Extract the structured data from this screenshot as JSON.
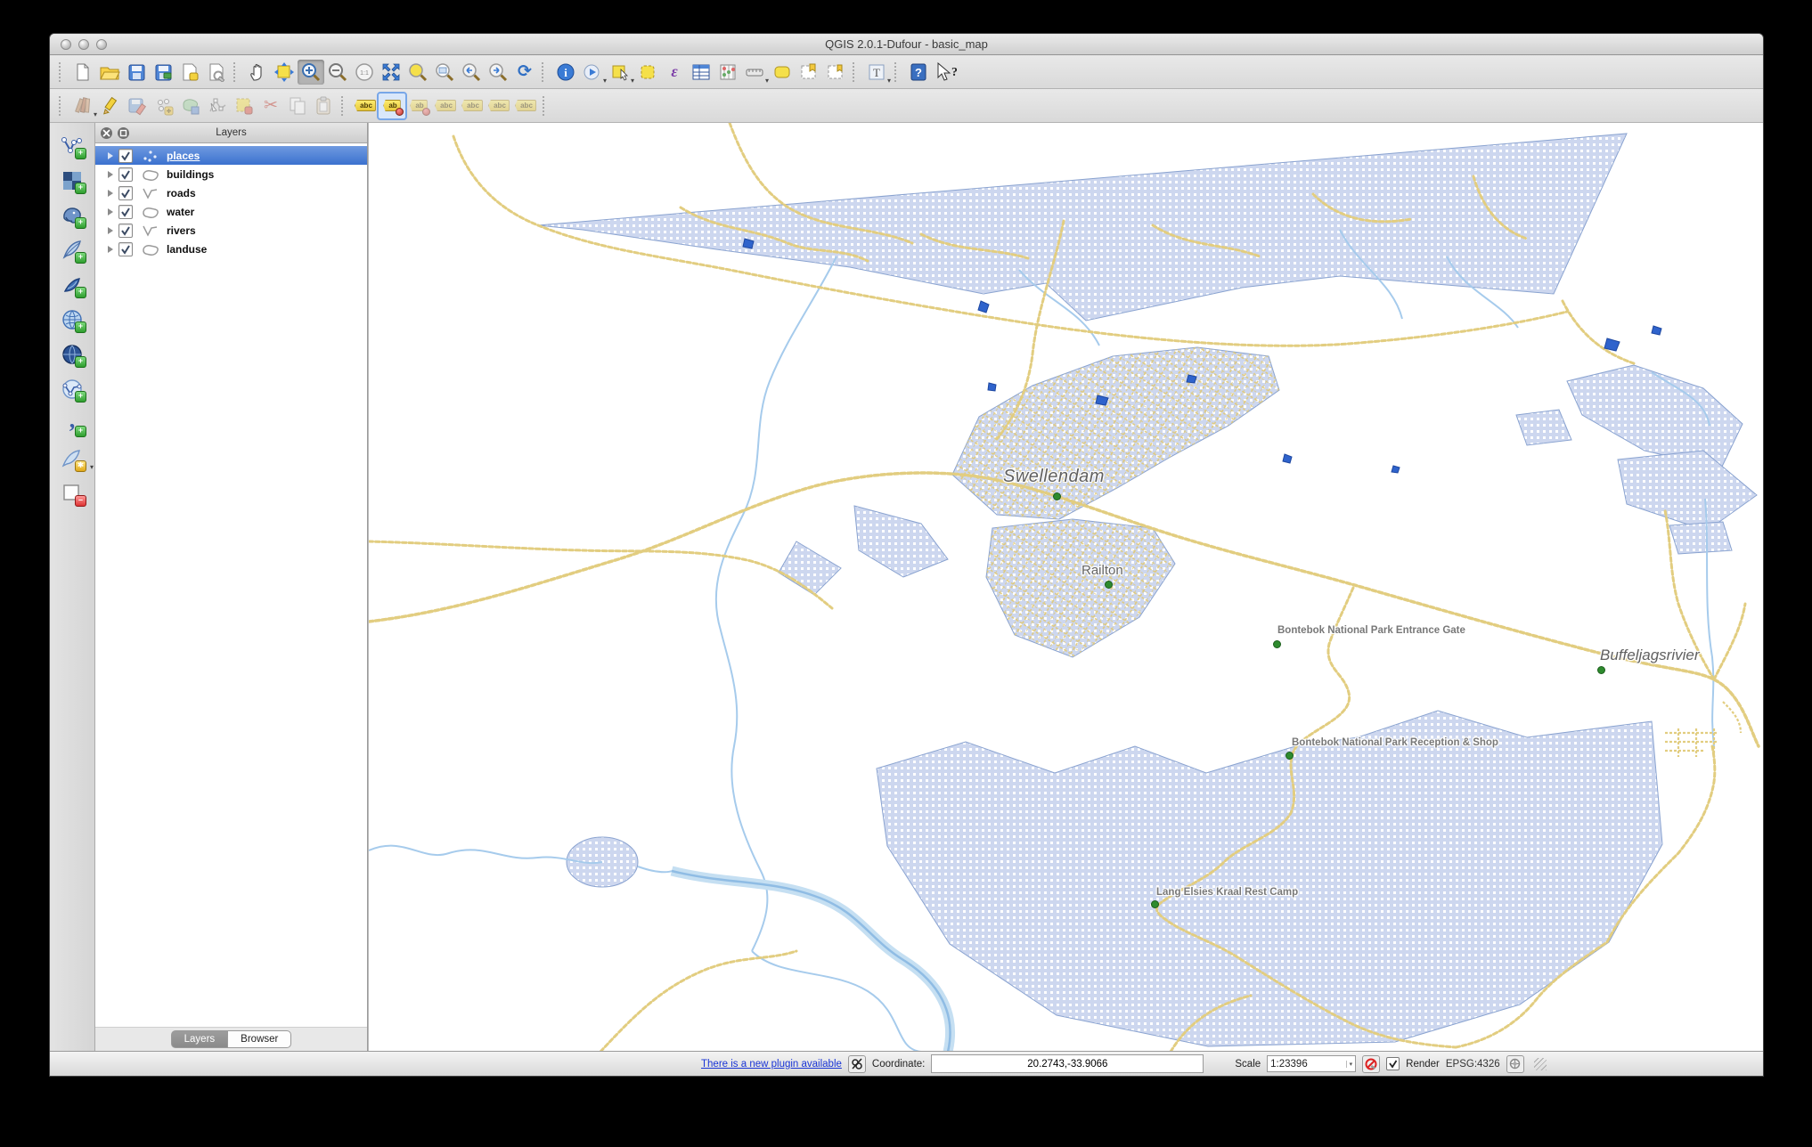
{
  "window": {
    "title": "QGIS 2.0.1-Dufour - basic_map"
  },
  "toolbar_text": {
    "zoom_native": "1:1",
    "identify": "i",
    "expression": "ε",
    "text_annotation": "T",
    "help": "?",
    "whats_this": "?",
    "label_abc": "abc",
    "label_ab": "ab"
  },
  "toolbars": {
    "main": [
      "new-project",
      "open-project",
      "save-project",
      "save-project-as",
      "new-print-composer",
      "composer-manager",
      "pan-map",
      "pan-to-selection",
      "zoom-in",
      "zoom-out",
      "zoom-native",
      "zoom-full",
      "zoom-to-selection",
      "zoom-to-layer",
      "zoom-last",
      "zoom-next",
      "refresh",
      "identify-features",
      "run-feature-action",
      "select-features",
      "deselect-features",
      "select-by-expression",
      "open-attribute-table",
      "field-calculator",
      "measure-line",
      "map-tips",
      "new-bookmark",
      "show-bookmarks",
      "text-annotation",
      "help-contents",
      "whats-this"
    ],
    "digitizing": [
      "current-edits",
      "toggle-editing",
      "save-layer-edits",
      "add-feature",
      "move-feature",
      "node-tool",
      "delete-selected",
      "cut-features",
      "copy-features",
      "paste-features"
    ],
    "labeling": [
      "layer-labeling-options",
      "pin-labels",
      "highlight-pinned-labels",
      "move-label",
      "rotate-label",
      "change-label",
      "change-label-properties"
    ],
    "manage_layers": [
      "add-vector-layer",
      "add-raster-layer",
      "add-postgis-layer",
      "add-spatialite-layer",
      "add-mssql-layer",
      "add-wms-layer",
      "add-wcs-layer",
      "add-wfs-layer",
      "add-delimited-text-layer",
      "new-shapefile-layer",
      "remove-layer"
    ]
  },
  "layers_panel": {
    "title": "Layers",
    "items": [
      {
        "label": "places",
        "type": "point",
        "checked": true,
        "selected": true
      },
      {
        "label": "buildings",
        "type": "polygon",
        "checked": true,
        "selected": false
      },
      {
        "label": "roads",
        "type": "line",
        "checked": true,
        "selected": false
      },
      {
        "label": "water",
        "type": "polygon",
        "checked": true,
        "selected": false
      },
      {
        "label": "rivers",
        "type": "line",
        "checked": true,
        "selected": false
      },
      {
        "label": "landuse",
        "type": "polygon",
        "checked": true,
        "selected": false
      }
    ],
    "tabs": [
      {
        "label": "Layers",
        "active": true
      },
      {
        "label": "Browser",
        "active": false
      }
    ]
  },
  "map": {
    "labels": [
      {
        "text": "Swellendam"
      },
      {
        "text": "Railton"
      },
      {
        "text": "Bontebok National Park Entrance Gate"
      },
      {
        "text": "Buffeljagsrivier"
      },
      {
        "text": "Bontebok National Park Reception & Shop"
      },
      {
        "text": "Lang Elsies Kraal Rest Camp"
      }
    ],
    "marker_color": "#2e8b2e",
    "colors": {
      "landuse_fill": "#cdd7ef",
      "landuse_border": "#8aa3d0",
      "road": "#e2cd80",
      "river": "#a6cbec",
      "water": "#2f63cc"
    }
  },
  "status_bar": {
    "plugin_link": "There is a new plugin available",
    "coordinate_label": "Coordinate:",
    "coordinate_value": "20.2743,-33.9066",
    "scale_label": "Scale",
    "scale_value": "1:23396",
    "render_label": "Render",
    "crs": "EPSG:4326"
  }
}
